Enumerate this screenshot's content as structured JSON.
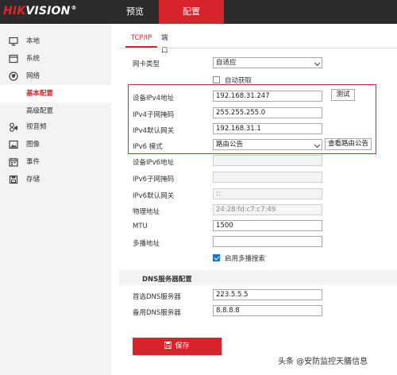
{
  "header": {
    "logo_hik": "HIK",
    "logo_vision": "VISION",
    "logo_reg": "®",
    "tabs": [
      {
        "label": "预览",
        "active": false
      },
      {
        "label": "配置",
        "active": true
      }
    ]
  },
  "sidebar": {
    "items": [
      {
        "label": "本地",
        "icon": "monitor-icon"
      },
      {
        "label": "系统",
        "icon": "system-icon"
      },
      {
        "label": "网络",
        "icon": "globe-icon"
      },
      {
        "label": "基本配置",
        "sub": true,
        "active": true
      },
      {
        "label": "高级配置",
        "sub": true,
        "active": false
      },
      {
        "label": "视音频",
        "icon": "audio-video-icon"
      },
      {
        "label": "图像",
        "icon": "image-icon"
      },
      {
        "label": "事件",
        "icon": "calendar-icon"
      },
      {
        "label": "存储",
        "icon": "storage-icon"
      }
    ]
  },
  "main": {
    "tabs": [
      {
        "label": "TCP/IP",
        "active": true
      },
      {
        "label": "端口",
        "active": false
      }
    ],
    "nic_type": {
      "label": "网卡类型",
      "value": "自适应"
    },
    "dhcp": {
      "label": "自动获取",
      "checked": false
    },
    "ipv4_address": {
      "label": "设备IPv4地址",
      "value": "192.168.31.247"
    },
    "test_button": "测试",
    "ipv4_mask": {
      "label": "IPv4子网掩码",
      "value": "255.255.255.0"
    },
    "ipv4_gateway": {
      "label": "IPv4默认网关",
      "value": "192.168.31.1"
    },
    "ipv6_mode": {
      "label": "IPv6 模式",
      "value": "路由公告"
    },
    "view_route_button": "查看路由公告",
    "ipv6_address": {
      "label": "设备IPv6地址",
      "value": ""
    },
    "ipv6_prefix": {
      "label": "IPv6子网掩码",
      "value": ""
    },
    "ipv6_gateway": {
      "label": "IPv6默认网关",
      "value": "::"
    },
    "mac_address": {
      "label": "物理地址",
      "value": "24:28:fd:c7:c7:49"
    },
    "mtu": {
      "label": "MTU",
      "value": "1500"
    },
    "multicast": {
      "label": "多播地址",
      "value": ""
    },
    "multicast_search": {
      "label": "启用多播搜索",
      "checked": true
    },
    "dns_section_title": "DNS服务器配置",
    "dns_primary": {
      "label": "首选DNS服务器",
      "value": "223.5.5.5"
    },
    "dns_secondary": {
      "label": "备用DNS服务器",
      "value": "8.8.8.8"
    },
    "save_button": "保存"
  },
  "watermark": "头条 @安防监控天膳信息",
  "colors": {
    "accent": "#d8232a",
    "topbar": "#2b2b2b",
    "sidebar_bg": "#f3f3f3",
    "checkbox_on": "#1a73c8"
  }
}
